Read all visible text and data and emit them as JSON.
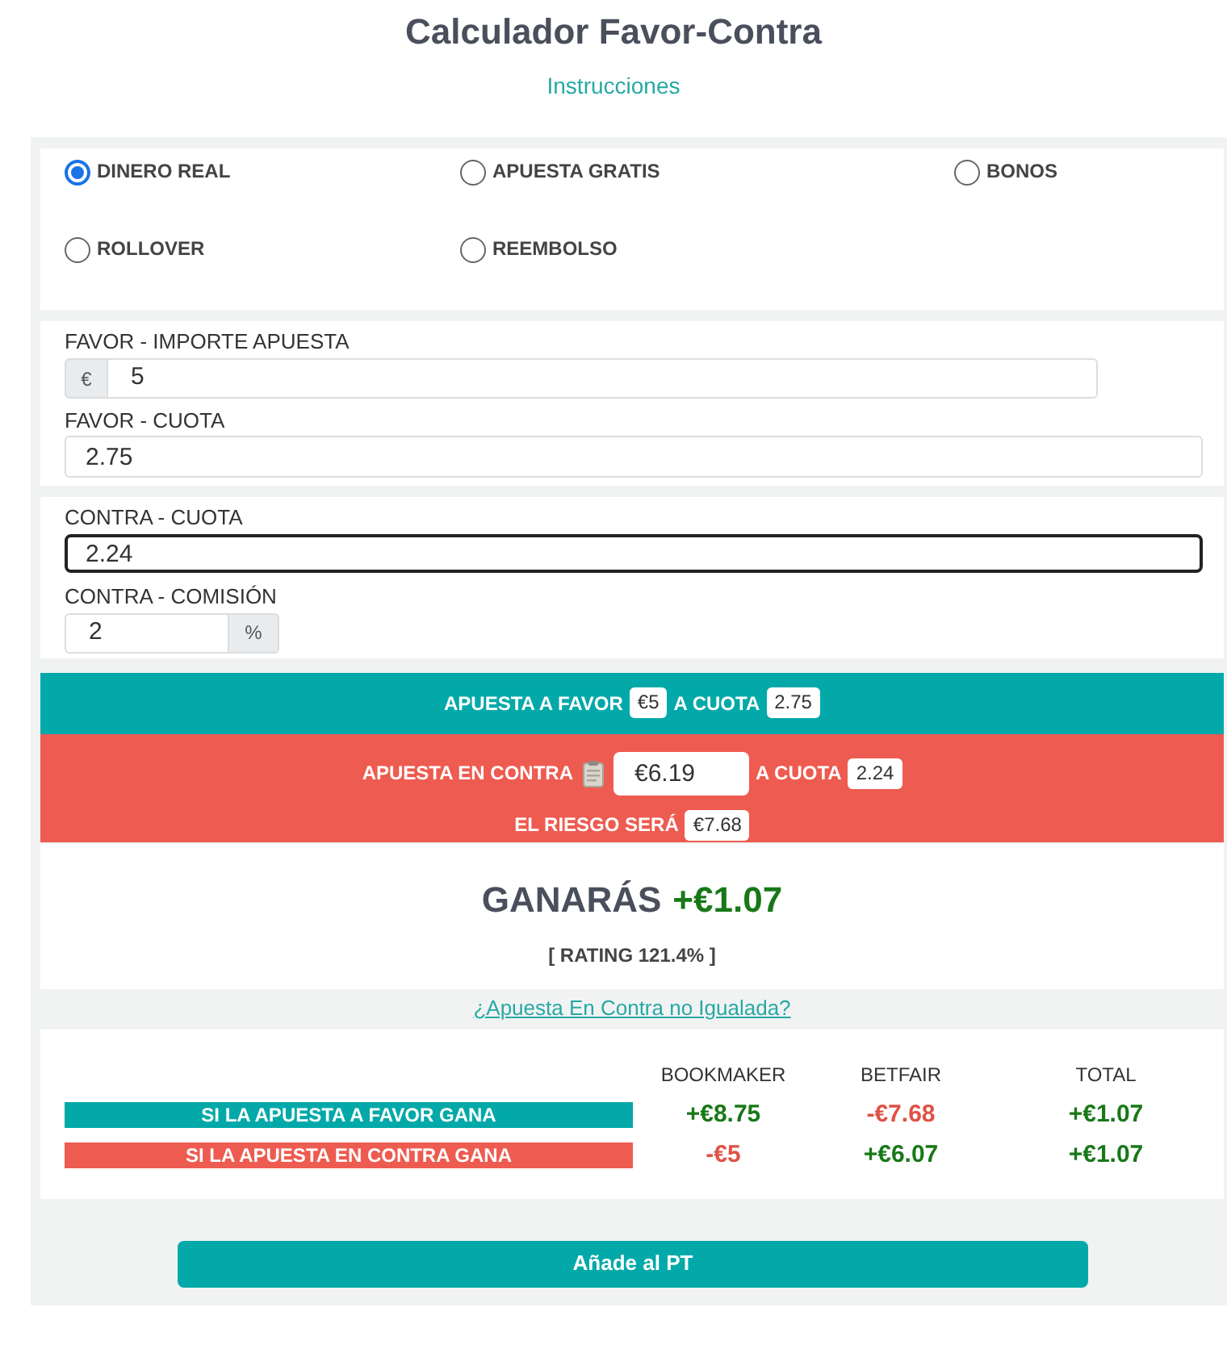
{
  "title": "Calculador Favor-Contra",
  "instructions_link": "Instrucciones",
  "bet_types": [
    {
      "label": "DINERO REAL",
      "selected": true
    },
    {
      "label": "APUESTA GRATIS",
      "selected": false
    },
    {
      "label": "BONOS",
      "selected": false
    },
    {
      "label": "ROLLOVER",
      "selected": false
    },
    {
      "label": "REEMBOLSO",
      "selected": false
    }
  ],
  "favor": {
    "stake": {
      "label": "FAVOR - IMPORTE APUESTA",
      "prefix": "€",
      "value": "5"
    },
    "odds": {
      "label": "FAVOR - CUOTA",
      "value": "2.75",
      "focused": false
    }
  },
  "contra": {
    "odds": {
      "label": "CONTRA - CUOTA",
      "value": "2.24",
      "focused": true
    },
    "commission": {
      "label": "CONTRA - COMISIÓN",
      "value": "2",
      "suffix": "%"
    }
  },
  "favor_summary": {
    "label": "APUESTA A FAVOR",
    "stake": "€5",
    "odds_label": "A CUOTA",
    "odds": "2.75"
  },
  "contra_summary": {
    "label": "APUESTA EN CONTRA",
    "stake": "€6.19",
    "odds_label": "A CUOTA",
    "odds": "2.24",
    "risk_label": "EL RIESGO SERÁ",
    "risk": "€7.68"
  },
  "result": {
    "label": "GANARÁS",
    "profit": {
      "text": "+€1.07",
      "kind": "gain"
    },
    "rating": "[ RATING 121.4% ]"
  },
  "unmatched_link": "¿Apuesta En Contra no Igualada?",
  "outcomes": {
    "columns": [
      "BOOKMAKER",
      "BETFAIR",
      "TOTAL"
    ],
    "rows": [
      {
        "label": "SI LA APUESTA A FAVOR GANA",
        "kind": "favor",
        "values": [
          {
            "text": "+€8.75",
            "kind": "gain"
          },
          {
            "text": "-€7.68",
            "kind": "loss"
          },
          {
            "text": "+€1.07",
            "kind": "gain"
          }
        ]
      },
      {
        "label": "SI LA APUESTA EN CONTRA GANA",
        "kind": "contra",
        "values": [
          {
            "text": "-€5",
            "kind": "loss"
          },
          {
            "text": "+€6.07",
            "kind": "gain"
          },
          {
            "text": "+€1.07",
            "kind": "gain"
          }
        ]
      }
    ]
  },
  "add_button": "Añade al PT"
}
